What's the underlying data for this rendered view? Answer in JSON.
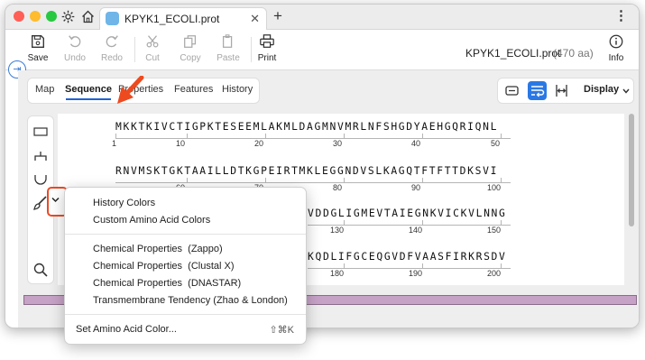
{
  "window": {
    "tab_title": "KPYK1_ECOLI.prot",
    "close_glyph": "✕",
    "new_tab_glyph": "+",
    "more_glyph": "⋮",
    "sidebar_toggle_glyph": "⇥"
  },
  "toolbar": {
    "save": "Save",
    "undo": "Undo",
    "redo": "Redo",
    "cut": "Cut",
    "copy": "Copy",
    "paste": "Paste",
    "print": "Print",
    "info": "Info",
    "doc_name": "KPYK1_ECOLI.prot",
    "doc_length": "(470 aa)"
  },
  "view_tabs": [
    "Map",
    "Sequence",
    "Properties",
    "Features",
    "History"
  ],
  "display_menu": "Display",
  "sequence": {
    "lines": [
      "MKKTKIVCTIGPKTESEEMLAKMLDAGMNVMRLNFSHGDYAEHGQRIQNL",
      "RNVMSKTGKTAAILLDTKGPEIRTMKLEGGNDVSLKAGQTFTFTTDKSVI",
      "VDDGLIGMEVTAIEGNKVICKVLNNG",
      "KQDLIFGCEQGVDFVAASFIRKRSDV"
    ],
    "ruler1": [
      "1",
      "10",
      "20",
      "30",
      "40",
      "50"
    ],
    "ruler2": [
      "60",
      "70",
      "80",
      "90",
      "100"
    ],
    "ruler3": [
      "130",
      "140",
      "150"
    ],
    "ruler4": [
      "180",
      "190",
      "200"
    ]
  },
  "dropdown": {
    "items_group1": [
      "History Colors",
      "Custom Amino Acid Colors"
    ],
    "items_group2": [
      "Chemical Properties  (Zappo)",
      "Chemical Properties  (Clustal X)",
      "Chemical Properties  (DNASTAR)",
      "Transmembrane Tendency (Zhao & London)"
    ],
    "set_color": "Set Amino Acid Color...",
    "set_color_shortcut": "⇧⌘K"
  },
  "colors": {
    "accent": "#2a78e4",
    "highlight_ring": "#ea4a26",
    "map_bar": "#c6a2c6"
  }
}
